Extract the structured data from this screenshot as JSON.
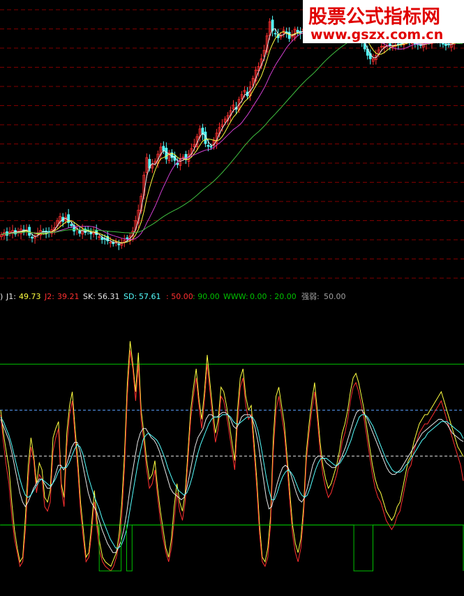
{
  "colors": {
    "background": "#000000",
    "candle_up": "#ff3030",
    "candle_down": "#54ffff",
    "ma_white": "#e8e8e8",
    "ma_yellow": "#ffff40",
    "ma_magenta": "#d040d0",
    "ma_green": "#40c040",
    "grid_red": "#800000",
    "j1": "#ffff40",
    "j2": "#ff3030",
    "sk": "#e8e8e8",
    "sd": "#54ffff",
    "level_red": "#ff3030",
    "level_green": "#00c000",
    "www": "#00c000",
    "strength": "#a0a0a0"
  },
  "watermark": {
    "title": "股票公式指标网",
    "url": "www.gszx.com.cn"
  },
  "indicator_legend": {
    "prefix": ")",
    "j1_label": "J1:",
    "j1_value": "49.73",
    "j2_label": "J2:",
    "j2_value": "39.21",
    "sk_label": "SK:",
    "sk_value": "56.31",
    "sd_label": "SD:",
    "sd_value": "57.61",
    "level_a": ": 50.00",
    "level_b": ": 90.00",
    "www_label": "WWW:",
    "www_value": "0.00",
    "level_c": ": 20.00",
    "strength_label": "强弱:",
    "strength_value": "50.00"
  },
  "chart_data": [
    {
      "type": "candlestick",
      "panel": "price",
      "x": [
        0,
        1,
        2,
        3,
        4,
        5,
        6,
        7,
        8,
        9,
        10,
        11,
        12,
        13,
        14,
        15,
        16,
        17,
        18,
        19,
        20,
        21,
        22,
        23,
        24,
        25,
        26,
        27,
        28,
        29,
        30,
        31,
        32,
        33,
        34,
        35,
        36,
        37,
        38,
        39,
        40,
        41,
        42,
        43,
        44,
        45,
        46,
        47,
        48,
        49,
        50,
        51,
        52,
        53,
        54,
        55,
        56,
        57,
        58,
        59,
        60,
        61,
        62,
        63,
        64,
        65,
        66,
        67,
        68,
        69,
        70,
        71,
        72,
        73,
        74,
        75,
        76,
        77,
        78,
        79,
        80,
        81,
        82,
        83,
        84,
        85,
        86,
        87,
        88,
        89,
        90,
        91,
        92,
        93,
        94,
        95,
        96,
        97,
        98,
        99,
        100,
        101,
        102,
        103,
        104,
        105,
        106,
        107,
        108,
        109,
        110,
        111,
        112,
        113,
        114,
        115,
        116,
        117,
        118,
        119,
        120,
        121,
        122,
        123,
        124,
        125,
        126,
        127,
        128,
        129,
        130,
        131,
        132,
        133,
        134,
        135,
        136,
        137,
        138,
        139,
        140,
        141,
        142,
        143,
        144,
        145,
        146,
        147,
        148,
        149,
        150,
        151,
        152,
        153,
        154,
        155,
        156,
        157,
        158,
        159,
        160,
        161,
        162,
        163,
        164,
        165
      ],
      "close": [
        27.5,
        27.8,
        27.4,
        27.9,
        28.1,
        27.6,
        28,
        28.3,
        27.9,
        28.2,
        27.4,
        27,
        27.3,
        27.8,
        28.1,
        27.9,
        27.6,
        27.9,
        28.2,
        28.5,
        29.5,
        30.1,
        29.4,
        30,
        29.2,
        28.8,
        28,
        28.4,
        27.7,
        28.2,
        27.8,
        28.1,
        27.6,
        27.9,
        27.5,
        27.2,
        26.8,
        26.9,
        26.6,
        26.4,
        26.2,
        26.5,
        26.1,
        26.3,
        26.7,
        26.9,
        27.3,
        28,
        29.5,
        31,
        33,
        36,
        38.5,
        37,
        37.5,
        38,
        39,
        40,
        39.5,
        38.3,
        39.2,
        38.5,
        38.1,
        37.5,
        38.3,
        38.6,
        38.2,
        39,
        39.8,
        40.4,
        41.5,
        42.6,
        41.8,
        40.5,
        40.1,
        40,
        40.9,
        42,
        42.8,
        43.2,
        44,
        44.5,
        45.2,
        46,
        45.4,
        46.8,
        47.5,
        48.1,
        47.3,
        48.6,
        49.8,
        51,
        51.5,
        52.6,
        53.8,
        55.9,
        57.9,
        56.6,
        56.2,
        55.6,
        55.9,
        56.7,
        56.4,
        55.5,
        55.9,
        56.8,
        56.4,
        56.2,
        56.8,
        56.5,
        56.5,
        56.4,
        56.9,
        57.1,
        57.3,
        57.4,
        57.2,
        57.2,
        57.1,
        57.3,
        57.5,
        57.2,
        57.1,
        57,
        57.2,
        56.7,
        56.8,
        56.3,
        55.8,
        55,
        54,
        53.1,
        52.6,
        52.6,
        53.1,
        53.9,
        54.4,
        54.4,
        54.5,
        54.5,
        54.5,
        54.6,
        54.7,
        54.8,
        55,
        55.2,
        55.1,
        54.9,
        54.7,
        54.6,
        54.5,
        54.7,
        54.9,
        55.1,
        55.3,
        55.4,
        55.4,
        55.1,
        54.7,
        54.5,
        54.6,
        54.8,
        55.1,
        55.3,
        55.5,
        55.8
      ],
      "axis": {
        "y_min": 20,
        "y_max": 60,
        "gridlines": "dashed-red"
      },
      "moving_averages": [
        "white",
        "yellow",
        "magenta",
        "green"
      ]
    },
    {
      "type": "line",
      "panel": "oscillator",
      "ylim": [
        -10,
        115
      ],
      "reference_levels": [
        90,
        50,
        20
      ],
      "series": [
        {
          "name": "J1",
          "color_key": "j1",
          "values": [
            70,
            60,
            52,
            45,
            30,
            18,
            10,
            4,
            6,
            24,
            46,
            58,
            50,
            38,
            47,
            44,
            32,
            30,
            35,
            58,
            62,
            65,
            38,
            32,
            60,
            72,
            78,
            62,
            48,
            30,
            18,
            6,
            8,
            20,
            35,
            22,
            12,
            6,
            4,
            3,
            2,
            5,
            8,
            16,
            30,
            52,
            82,
            100,
            90,
            78,
            95,
            70,
            60,
            48,
            40,
            42,
            48,
            36,
            26,
            18,
            10,
            6,
            14,
            28,
            38,
            30,
            26,
            34,
            52,
            70,
            80,
            88,
            75,
            66,
            78,
            94,
            82,
            70,
            60,
            66,
            80,
            78,
            72,
            64,
            56,
            48,
            70,
            84,
            88,
            76,
            70,
            72,
            56,
            40,
            20,
            6,
            4,
            10,
            24,
            58,
            76,
            80,
            72,
            64,
            50,
            34,
            20,
            12,
            8,
            14,
            28,
            52,
            64,
            74,
            82,
            70,
            56,
            46,
            40,
            36,
            38,
            42,
            46,
            52,
            60,
            64,
            70,
            78,
            84,
            86,
            82,
            76,
            70,
            62,
            54,
            46,
            40,
            36,
            34,
            30,
            26,
            24,
            22,
            24,
            28,
            30,
            36,
            42,
            48,
            50,
            56,
            60,
            64,
            66,
            68,
            68,
            70,
            72,
            74,
            76,
            78,
            74,
            70,
            66,
            62,
            58,
            54,
            52,
            49.73
          ]
        },
        {
          "name": "J2",
          "color_key": "j2",
          "values": [
            68,
            56,
            46,
            38,
            24,
            14,
            8,
            2,
            4,
            18,
            40,
            54,
            48,
            34,
            42,
            40,
            28,
            26,
            30,
            52,
            58,
            62,
            36,
            28,
            54,
            68,
            74,
            58,
            44,
            26,
            14,
            4,
            6,
            16,
            30,
            18,
            8,
            4,
            2,
            1,
            0,
            2,
            6,
            12,
            24,
            46,
            76,
            96,
            88,
            74,
            90,
            66,
            56,
            44,
            36,
            38,
            44,
            32,
            22,
            14,
            8,
            4,
            10,
            22,
            34,
            26,
            22,
            30,
            48,
            66,
            76,
            84,
            72,
            62,
            74,
            90,
            78,
            66,
            56,
            62,
            76,
            74,
            68,
            60,
            52,
            44,
            64,
            80,
            84,
            72,
            66,
            68,
            52,
            36,
            16,
            4,
            2,
            6,
            20,
            52,
            70,
            76,
            68,
            60,
            46,
            30,
            16,
            8,
            4,
            10,
            24,
            48,
            60,
            70,
            78,
            66,
            52,
            42,
            36,
            32,
            34,
            38,
            42,
            48,
            56,
            60,
            66,
            74,
            80,
            82,
            78,
            72,
            66,
            58,
            50,
            42,
            36,
            32,
            30,
            26,
            22,
            20,
            18,
            20,
            24,
            26,
            32,
            38,
            44,
            46,
            52,
            56,
            60,
            62,
            64,
            64,
            66,
            68,
            70,
            72,
            74,
            70,
            66,
            62,
            58,
            54,
            50,
            46,
            39.21
          ]
        },
        {
          "name": "SK",
          "color_key": "sk",
          "values": [
            66,
            63,
            60,
            57,
            52,
            46,
            40,
            34,
            30,
            28,
            30,
            33,
            36,
            38,
            40,
            40,
            38,
            36,
            36,
            38,
            42,
            46,
            46,
            44,
            46,
            50,
            54,
            56,
            56,
            52,
            46,
            40,
            34,
            30,
            28,
            26,
            22,
            18,
            15,
            12,
            10,
            8,
            8,
            10,
            13,
            18,
            25,
            34,
            42,
            49,
            56,
            60,
            62,
            62,
            60,
            58,
            57,
            55,
            52,
            48,
            44,
            40,
            36,
            34,
            33,
            32,
            31,
            32,
            36,
            42,
            48,
            54,
            58,
            60,
            62,
            66,
            68,
            68,
            67,
            67,
            68,
            69,
            69,
            68,
            66,
            63,
            62,
            64,
            67,
            68,
            68,
            68,
            66,
            62,
            56,
            48,
            40,
            32,
            27,
            28,
            33,
            38,
            42,
            45,
            46,
            45,
            42,
            38,
            34,
            31,
            30,
            32,
            36,
            41,
            46,
            49,
            50,
            50,
            49,
            47,
            46,
            45,
            45,
            46,
            48,
            51,
            54,
            58,
            62,
            66,
            69,
            70,
            70,
            68,
            66,
            63,
            60,
            57,
            54,
            51,
            48,
            45,
            43,
            42,
            42,
            43,
            44,
            46,
            48,
            50,
            52,
            54,
            56,
            58,
            60,
            61,
            62,
            63,
            64,
            65,
            66,
            66,
            65,
            64,
            62,
            60,
            59,
            58,
            57,
            56.31
          ]
        },
        {
          "name": "SD",
          "color_key": "sd",
          "values": [
            67,
            65,
            62,
            59,
            55,
            50,
            45,
            40,
            36,
            33,
            32,
            33,
            35,
            37,
            39,
            40,
            39,
            38,
            37,
            38,
            40,
            43,
            45,
            45,
            45,
            47,
            50,
            53,
            55,
            54,
            51,
            46,
            41,
            37,
            33,
            30,
            27,
            23,
            20,
            17,
            14,
            12,
            10,
            10,
            11,
            14,
            18,
            25,
            32,
            39,
            46,
            52,
            57,
            59,
            60,
            59,
            58,
            57,
            55,
            52,
            49,
            45,
            42,
            39,
            37,
            35,
            34,
            33,
            34,
            37,
            41,
            46,
            51,
            55,
            58,
            61,
            64,
            66,
            67,
            67,
            67,
            68,
            68,
            68,
            67,
            65,
            64,
            64,
            65,
            66,
            67,
            67,
            67,
            65,
            61,
            55,
            48,
            41,
            35,
            31,
            31,
            34,
            38,
            41,
            43,
            44,
            43,
            41,
            38,
            35,
            33,
            32,
            33,
            36,
            40,
            44,
            47,
            49,
            49,
            49,
            48,
            47,
            46,
            46,
            47,
            49,
            51,
            54,
            57,
            61,
            64,
            67,
            68,
            68,
            67,
            65,
            63,
            60,
            57,
            54,
            51,
            48,
            46,
            44,
            43,
            43,
            43,
            44,
            46,
            47,
            49,
            51,
            53,
            55,
            57,
            58,
            60,
            61,
            62,
            63,
            64,
            65,
            65,
            65,
            64,
            63,
            62,
            61,
            60,
            57.61
          ]
        },
        {
          "name": "WWW",
          "color_key": "www",
          "values": [
            20,
            20,
            20,
            20,
            20,
            20,
            20,
            20,
            20,
            20,
            20,
            20,
            20,
            20,
            20,
            20,
            20,
            20,
            20,
            20,
            20,
            20,
            20,
            20,
            20,
            20,
            20,
            20,
            20,
            20,
            20,
            20,
            20,
            20,
            20,
            20,
            0,
            0,
            0,
            0,
            0,
            0,
            0,
            0,
            20,
            20,
            0,
            0,
            20,
            20,
            20,
            20,
            20,
            20,
            20,
            20,
            20,
            20,
            20,
            20,
            20,
            20,
            20,
            20,
            20,
            20,
            20,
            20,
            20,
            20,
            20,
            20,
            20,
            20,
            20,
            20,
            20,
            20,
            20,
            20,
            20,
            20,
            20,
            20,
            20,
            20,
            20,
            20,
            20,
            20,
            20,
            20,
            20,
            20,
            20,
            20,
            20,
            20,
            20,
            20,
            20,
            20,
            20,
            20,
            20,
            20,
            20,
            20,
            20,
            20,
            20,
            20,
            20,
            20,
            20,
            20,
            20,
            20,
            20,
            20,
            20,
            20,
            20,
            20,
            20,
            20,
            20,
            20,
            20,
            0,
            0,
            0,
            0,
            0,
            0,
            0,
            20,
            20,
            20,
            20,
            20,
            20,
            20,
            20,
            20,
            20,
            20,
            20,
            20,
            20,
            20,
            20,
            20,
            20,
            20,
            20,
            20,
            20,
            20,
            20,
            20,
            20,
            20,
            20,
            20,
            20,
            20,
            20,
            20,
            0.0
          ]
        }
      ]
    }
  ]
}
